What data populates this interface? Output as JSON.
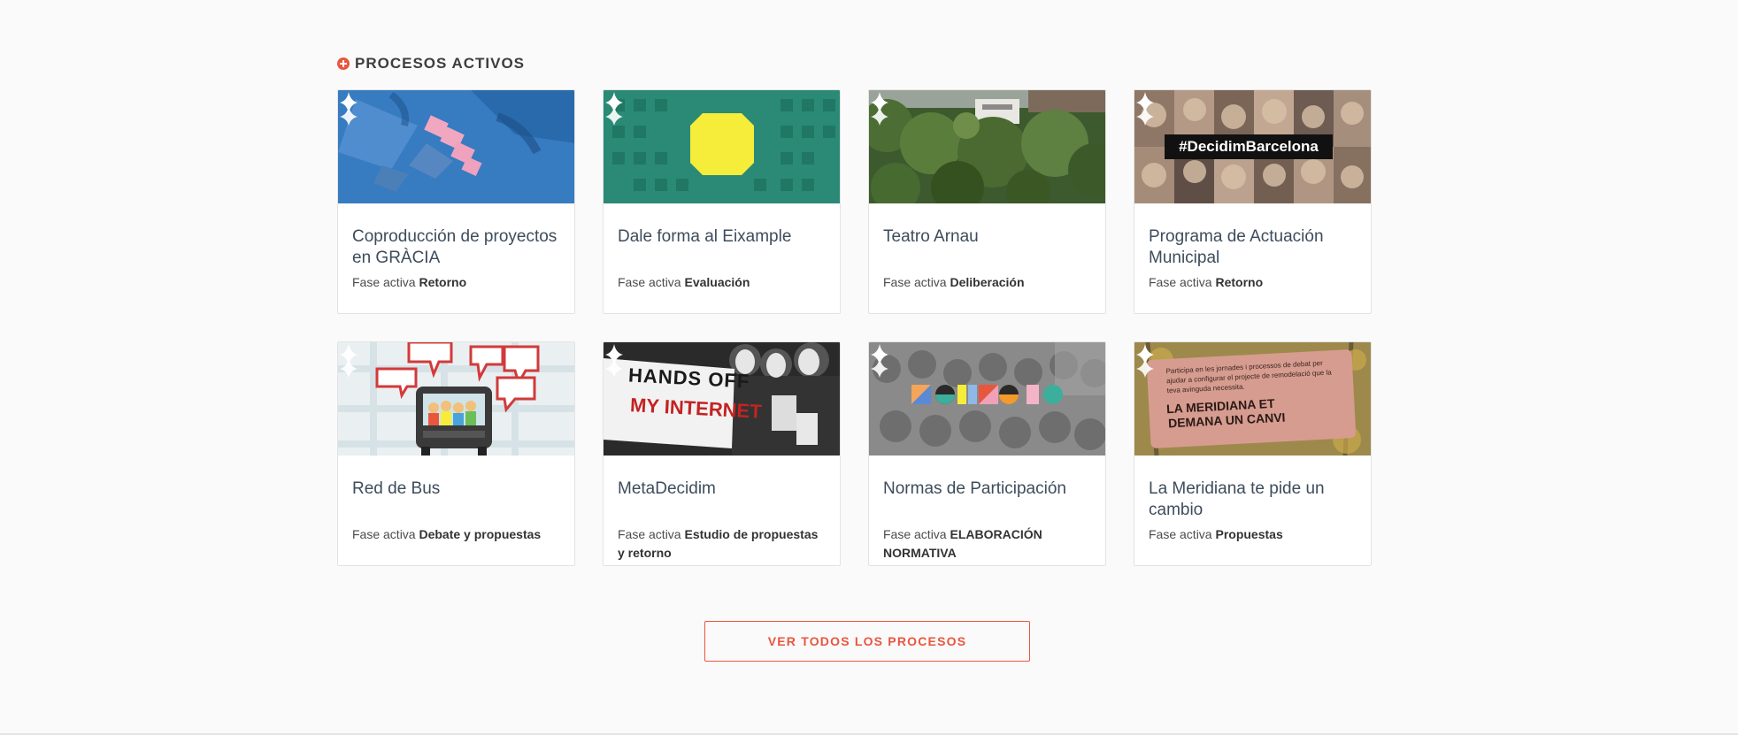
{
  "section": {
    "title": "PROCESOS ACTIVOS"
  },
  "cards": [
    {
      "title": "Coproducción de proyectos en GRÀCIA",
      "phase_prefix": "Fase activa",
      "phase": "Retorno"
    },
    {
      "title": "Dale forma al Eixample",
      "phase_prefix": "Fase activa",
      "phase": "Evaluación"
    },
    {
      "title": "Teatro Arnau",
      "phase_prefix": "Fase activa",
      "phase": "Deliberación"
    },
    {
      "title": "Programa de Actuación Municipal",
      "phase_prefix": "Fase activa",
      "phase": "Retorno"
    },
    {
      "title": "Red de Bus",
      "phase_prefix": "Fase activa",
      "phase": "Debate y propuestas"
    },
    {
      "title": "MetaDecidim",
      "phase_prefix": "Fase activa",
      "phase": "Estudio de propuestas y retorno"
    },
    {
      "title": "Normas de Participación",
      "phase_prefix": "Fase activa",
      "phase": "ELABORACIÓN NORMATIVA"
    },
    {
      "title": "La Meridiana te pide un cambio",
      "phase_prefix": "Fase activa",
      "phase": "Propuestas"
    }
  ],
  "images": {
    "hashtag": "#DecidimBarcelona",
    "protest_sign": [
      "HANDS OFF",
      "MY INTERNET"
    ],
    "meridiana_sign_small": "Participa en les jornades i processos de debat per ajudar a configurar el projecte de remodelació que la teva avinguda necessita.",
    "meridiana_sign_big": [
      "LA MERIDIANA ET",
      "DEMANA UN CANVI"
    ]
  },
  "button": {
    "label": "VER TODOS LOS PROCESOS"
  },
  "colors": {
    "accent": "#e9563e"
  }
}
